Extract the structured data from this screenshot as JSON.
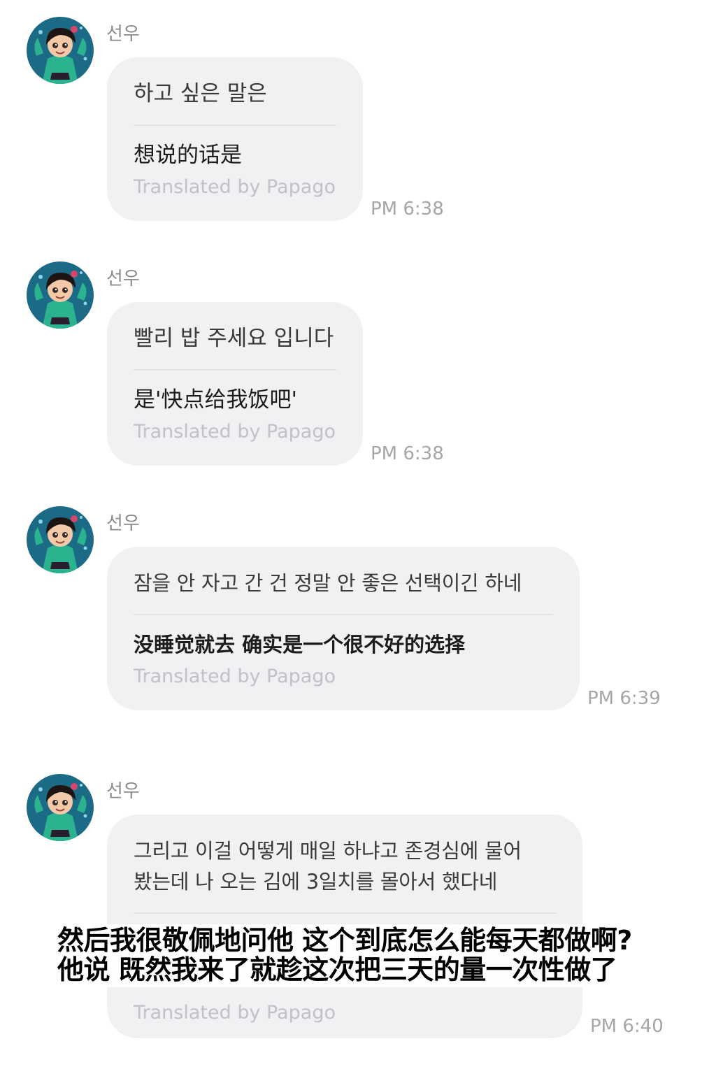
{
  "messages": [
    {
      "sender": "선우",
      "original": "하고 싶은 말은",
      "translation": "想说的话是",
      "translated_by": "Translated by Papago",
      "time": "PM 6:38"
    },
    {
      "sender": "선우",
      "original": "빨리 밥 주세요 입니다",
      "translation": "是'快点给我饭吧'",
      "translated_by": "Translated by Papago",
      "time": "PM 6:38"
    },
    {
      "sender": "선우",
      "original": "잠을 안 자고 간 건 정말 안 좋은 선택이긴 하네",
      "translation": "没睡觉就去 确实是一个很不好的选择",
      "translated_by": "Translated by Papago",
      "time": "PM 6:39"
    },
    {
      "sender": "선우",
      "original": "그리고 이걸 어떻게 매일 하냐고 존경심에 물어\n봤는데 나 오는 김에 3일치를 몰아서 했다네",
      "translation": "",
      "translated_by": "Translated by Papago",
      "time": "PM 6:40"
    }
  ],
  "subtitle": {
    "line1": "然后我很敬佩地问他 这个到底怎么能每天都做啊?",
    "line2": "他说 既然我来了就趁这次把三天的量一次性做了"
  },
  "colors": {
    "bubble": "#f1f1f3",
    "sender": "#8a8a8e",
    "time": "#a5a5aa",
    "papago": "#c1c1c6"
  }
}
